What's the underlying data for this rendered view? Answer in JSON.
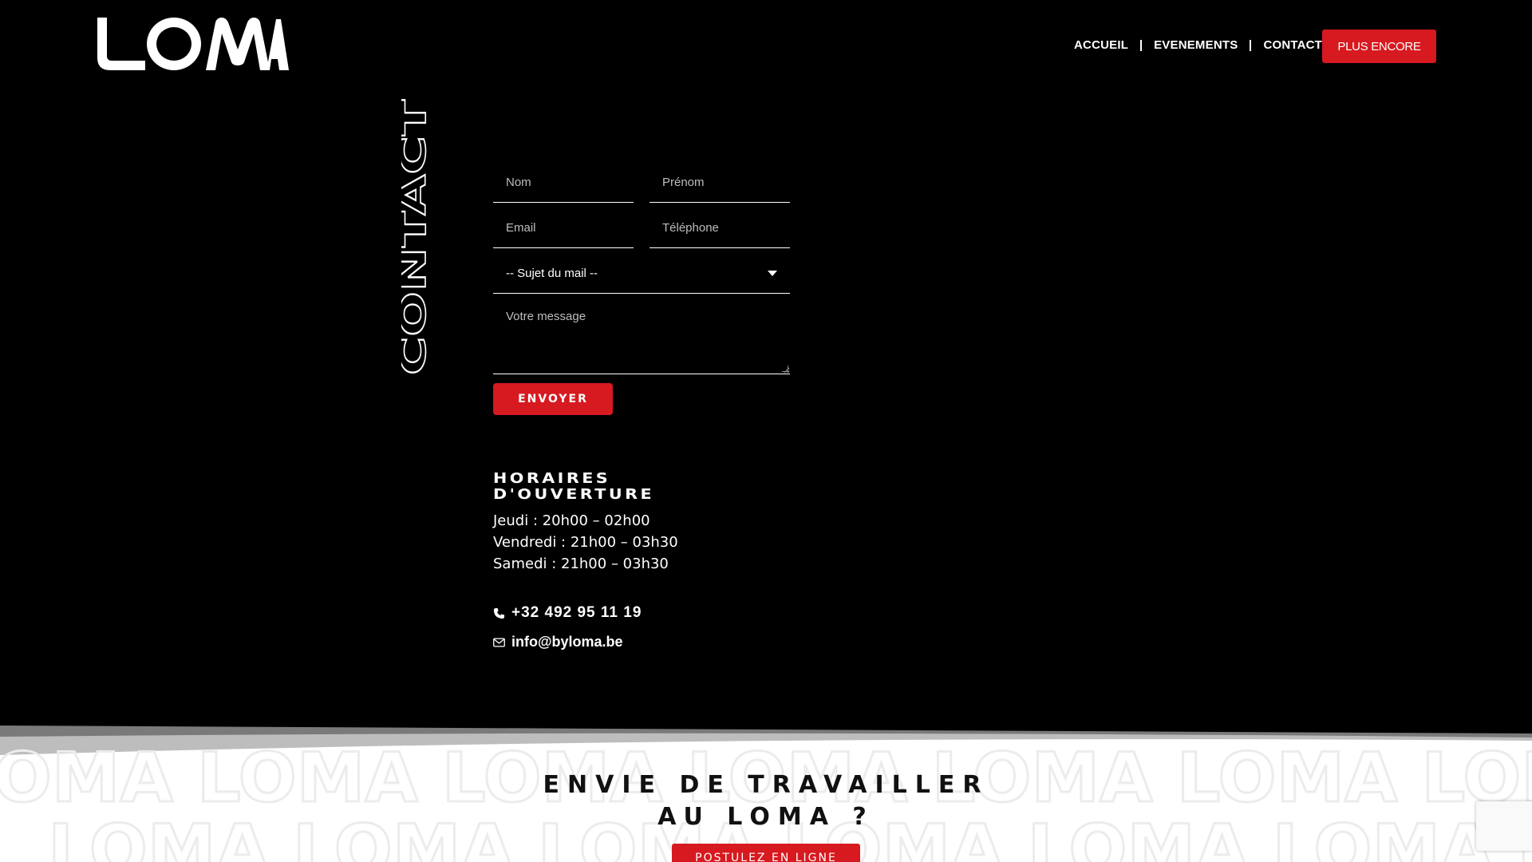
{
  "brand": {
    "logo_text": "LOMA",
    "accent_color": "#d71920"
  },
  "nav": {
    "items": [
      {
        "label": "ACCUEIL"
      },
      {
        "label": "EVENEMENTS"
      },
      {
        "label": "CONTACT"
      }
    ],
    "cta_label": "PLUS ENCORE"
  },
  "contact_section": {
    "vertical_title": "CONTACT",
    "form": {
      "nom_placeholder": "Nom",
      "prenom_placeholder": "Prénom",
      "email_placeholder": "Email",
      "telephone_placeholder": "Téléphone",
      "subject_selected": "-- Sujet du mail --",
      "message_placeholder": "Votre message",
      "submit_label": "ENVOYER"
    },
    "hours": {
      "title_line1": "HORAIRES",
      "title_line2": "D'OUVERTURE",
      "lines": [
        "Jeudi : 20h00 – 02h00",
        "Vendredi : 21h00 – 03h30",
        "Samedi : 21h00 – 03h30"
      ]
    },
    "phone": "+32 492 95 11 19",
    "email": "info@byloma.be",
    "icons": {
      "phone": "phone-icon",
      "email": "envelope-icon"
    }
  },
  "jobs_section": {
    "title_line1": "ENVIE DE TRAVAILLER",
    "title_line2": "AU LOMA ?",
    "button_label": "POSTULEZ EN LIGNE"
  }
}
